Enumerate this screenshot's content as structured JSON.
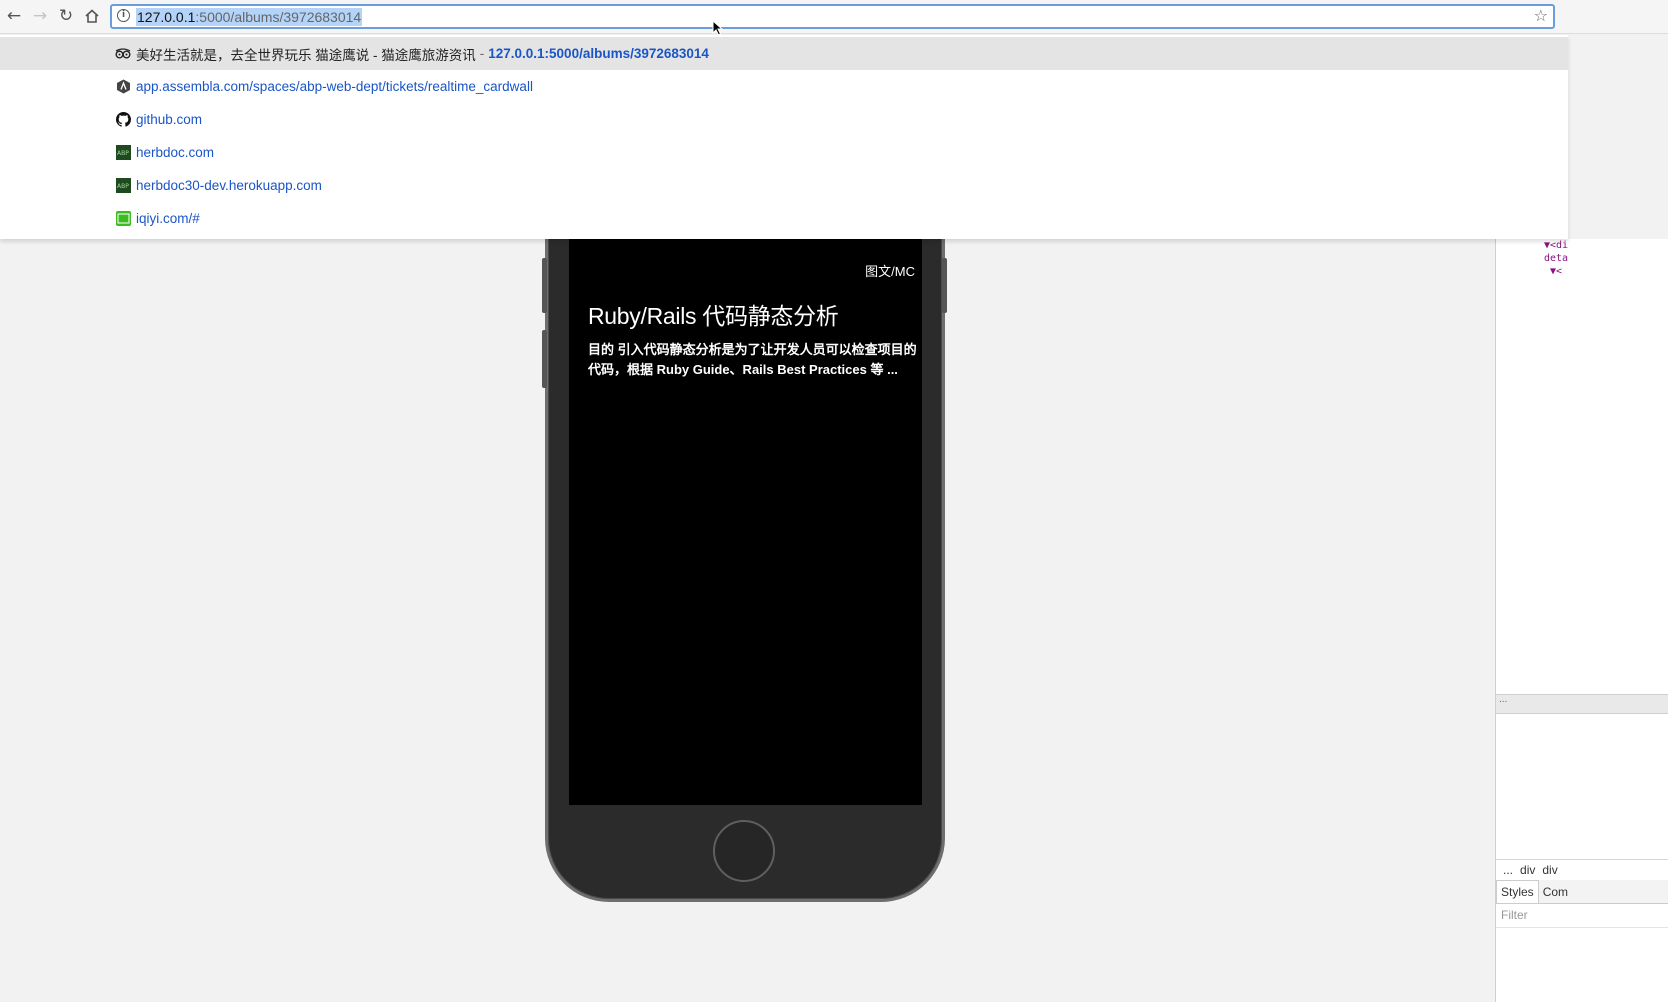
{
  "browser": {
    "address": {
      "host": "127.0.0.1",
      "rest": ":5000/albums/3972683014"
    }
  },
  "suggestions": [
    {
      "title": "美好生活就是，去全世界玩乐 猫途鹰说 - 猫途鹰旅游资讯",
      "sep": "-",
      "url": "127.0.0.1:5000/albums/3972683014",
      "icon": "tripadvisor-icon",
      "selected": true
    },
    {
      "title": "",
      "sep": "",
      "url": "app.assembla.com/spaces/abp-web-dept/tickets/realtime_cardwall",
      "icon": "assembla-icon",
      "selected": false
    },
    {
      "title": "",
      "sep": "",
      "url": "github.com",
      "icon": "github-icon",
      "selected": false
    },
    {
      "title": "",
      "sep": "",
      "url": "herbdoc.com",
      "icon": "abp-icon",
      "selected": false
    },
    {
      "title": "",
      "sep": "",
      "url": "herbdoc30-dev.herokuapp.com",
      "icon": "abp-icon",
      "selected": false
    },
    {
      "title": "",
      "sep": "",
      "url": "iqiyi.com/#",
      "icon": "iqiyi-icon",
      "selected": false
    }
  ],
  "article": {
    "credit": "图文/MC",
    "title": "Ruby/Rails 代码静态分析",
    "excerpt": "目的 引入代码静态分析是为了让开发人员可以检查项目的代码，根据 Ruby Guide、Rails Best Practices 等 ..."
  },
  "devtools": {
    "code_lines": "▼<di\ndeta\n ▼<\n   \n   ",
    "divider": "...",
    "crumbs": [
      "...",
      "div",
      "div"
    ],
    "tabs": [
      "Styles",
      "Com"
    ],
    "filter_placeholder": "Filter"
  },
  "colors": {
    "accent": "#1a55c7",
    "omnibox_border": "#6a9ddd",
    "selection": "#b3d3f9"
  }
}
